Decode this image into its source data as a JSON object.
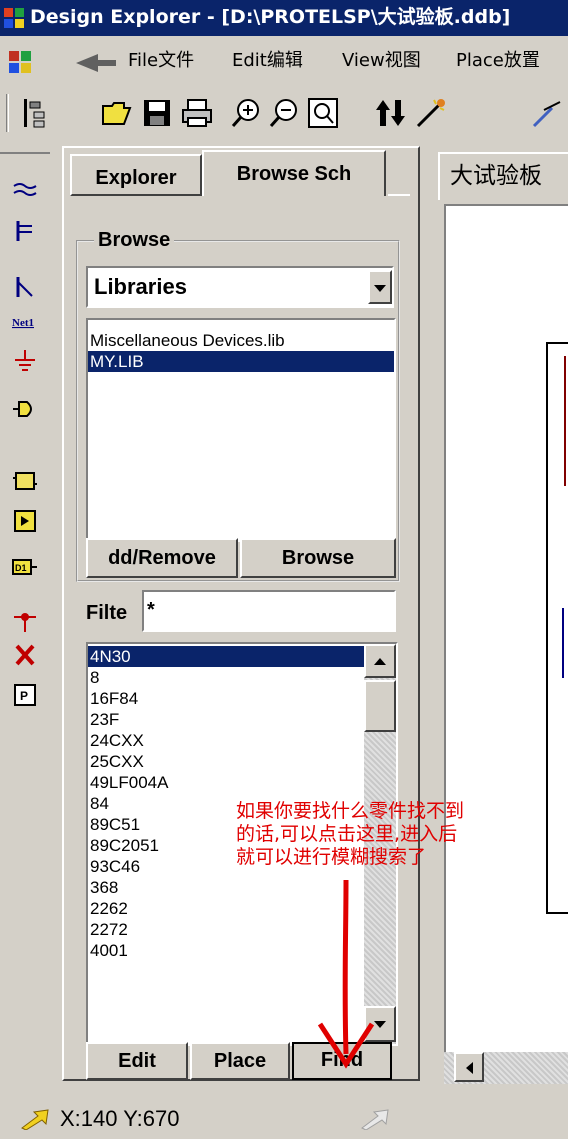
{
  "window": {
    "title": "Design Explorer - [D:\\PROTELSP\\大试验板.ddb]"
  },
  "menu": [
    {
      "label": "File文件"
    },
    {
      "label": "Edit编辑"
    },
    {
      "label": "View视图"
    },
    {
      "label": "Place放置"
    }
  ],
  "panel": {
    "tabs": [
      {
        "label": "Explorer"
      },
      {
        "label": "Browse Sch"
      }
    ],
    "browse_group_label": "Browse",
    "browse_dropdown_value": "Libraries",
    "libraries": [
      {
        "name": "Miscellaneous Devices.lib"
      },
      {
        "name": "MY.LIB"
      }
    ],
    "add_remove_label": "dd/Remove",
    "browse_button_label": "Browse",
    "filter_label": "Filte",
    "filter_value": "*",
    "components": [
      {
        "name": "4N30"
      },
      {
        "name": "8"
      },
      {
        "name": "16F84"
      },
      {
        "name": "23F"
      },
      {
        "name": "24CXX"
      },
      {
        "name": "25CXX"
      },
      {
        "name": "49LF004A"
      },
      {
        "name": "84"
      },
      {
        "name": "89C51"
      },
      {
        "name": "89C2051"
      },
      {
        "name": "93C46"
      },
      {
        "name": "368"
      },
      {
        "name": "2262"
      },
      {
        "name": "2272"
      },
      {
        "name": "4001"
      }
    ],
    "edit_label": "Edit",
    "place_label": "Place",
    "find_label": "Find"
  },
  "document": {
    "tab_label": "大试验板"
  },
  "status": {
    "coordinates": "X:140 Y:670"
  },
  "annotation": {
    "lines": [
      "如果你要找什么零件找不到",
      "的话,可以点击这里,进入后",
      "就可以进行模糊搜索了"
    ]
  },
  "colors": {
    "titlebar": "#0a246a",
    "face": "#d4d0c8",
    "selection": "#0a246a",
    "annotation": "#e00000",
    "schematic_line": "#800000"
  }
}
